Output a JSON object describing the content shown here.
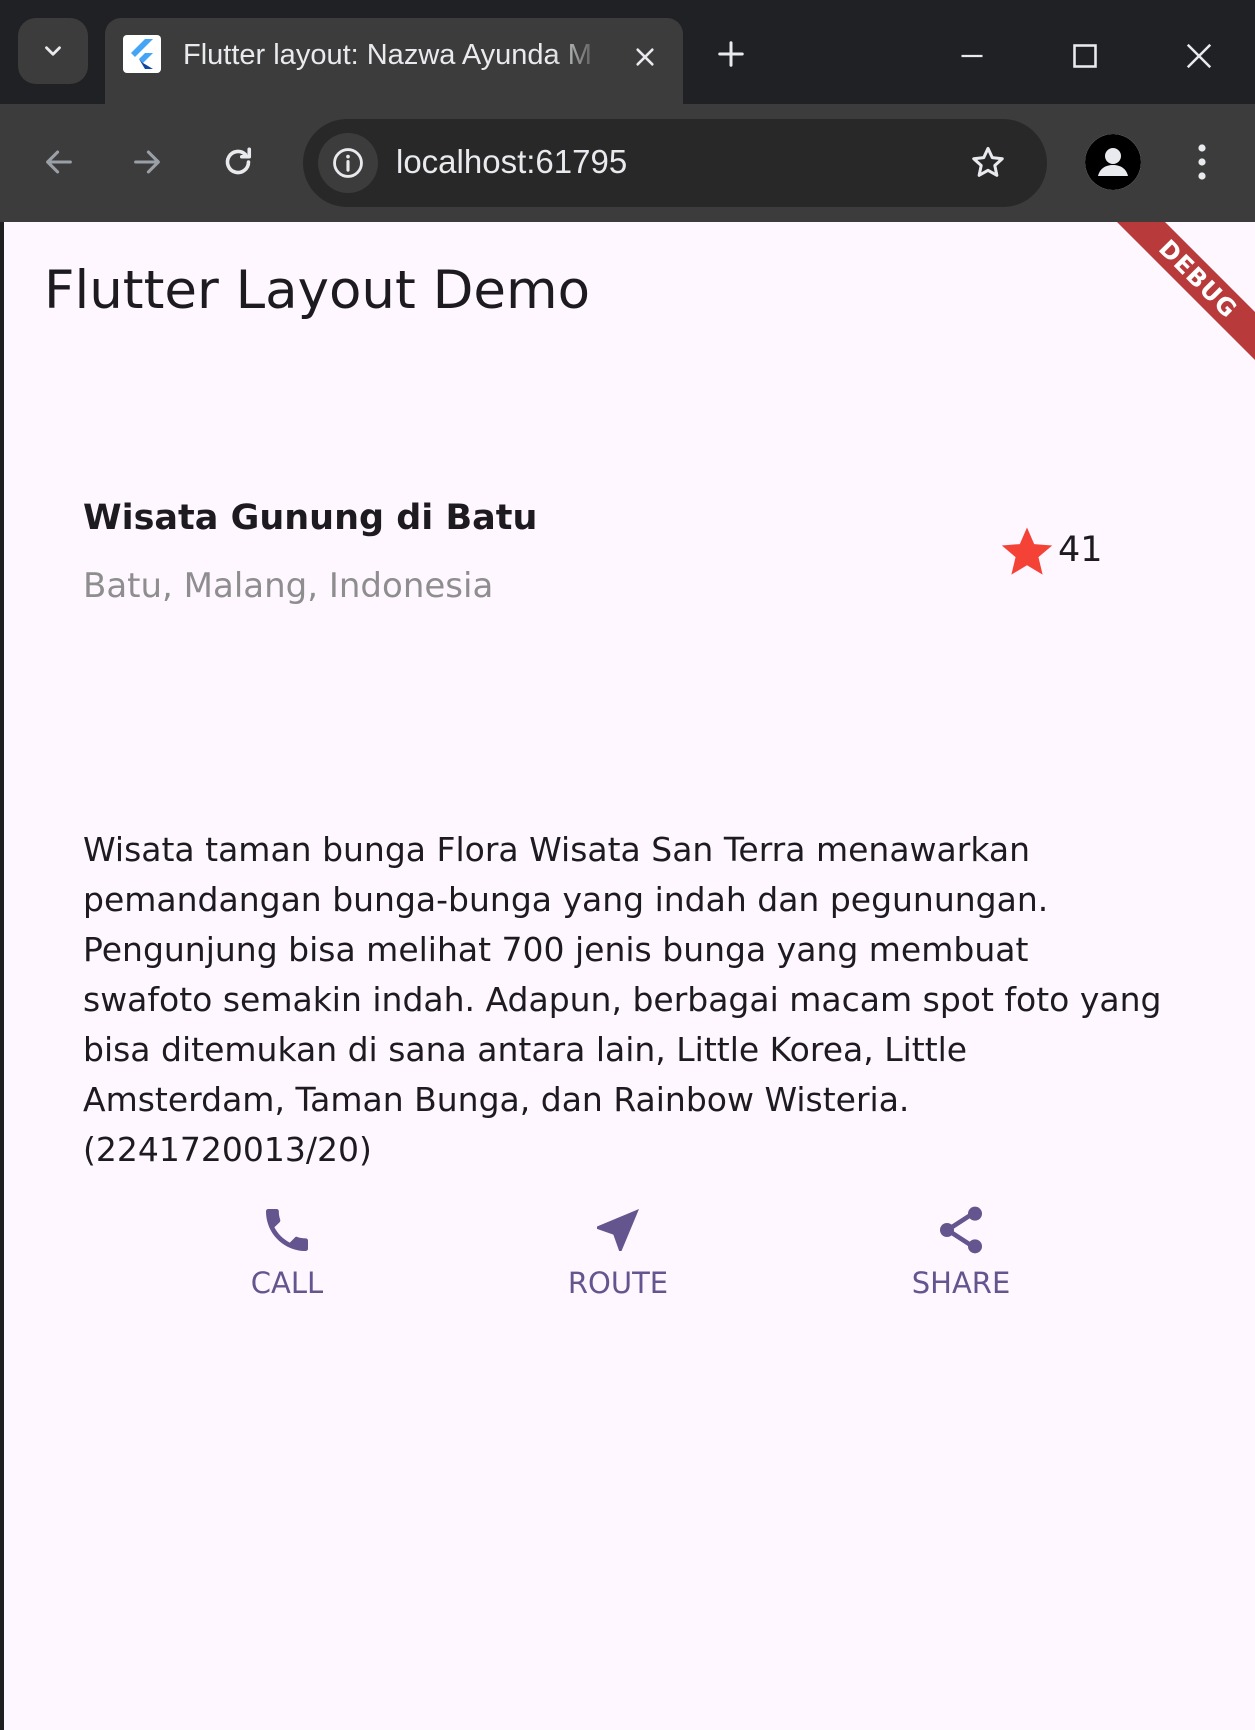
{
  "browser": {
    "tab_title": "Flutter layout: Nazwa Ayunda M",
    "url": "localhost:61795"
  },
  "app": {
    "title": "Flutter Layout Demo",
    "debug_banner": "DEBUG",
    "place": {
      "name": "Wisata Gunung di Batu",
      "location": "Batu, Malang, Indonesia",
      "rating_count": "41"
    },
    "description": "Wisata taman bunga Flora Wisata San Terra menawarkan pemandangan bunga-bunga yang indah dan pegunungan. Pengunjung bisa melihat 700 jenis bunga yang membuat swafoto semakin indah. Adapun, berbagai macam spot foto yang bisa ditemukan di sana antara lain, Little Korea, Little Amsterdam, Taman Bunga, dan Rainbow Wisteria.(2241720013/20)",
    "actions": [
      {
        "label": "CALL",
        "icon": "phone-icon"
      },
      {
        "label": "ROUTE",
        "icon": "near-me-icon"
      },
      {
        "label": "SHARE",
        "icon": "share-icon"
      }
    ]
  },
  "colors": {
    "accent": "#65558f",
    "star": "#f44336",
    "background": "#fef7ff"
  }
}
